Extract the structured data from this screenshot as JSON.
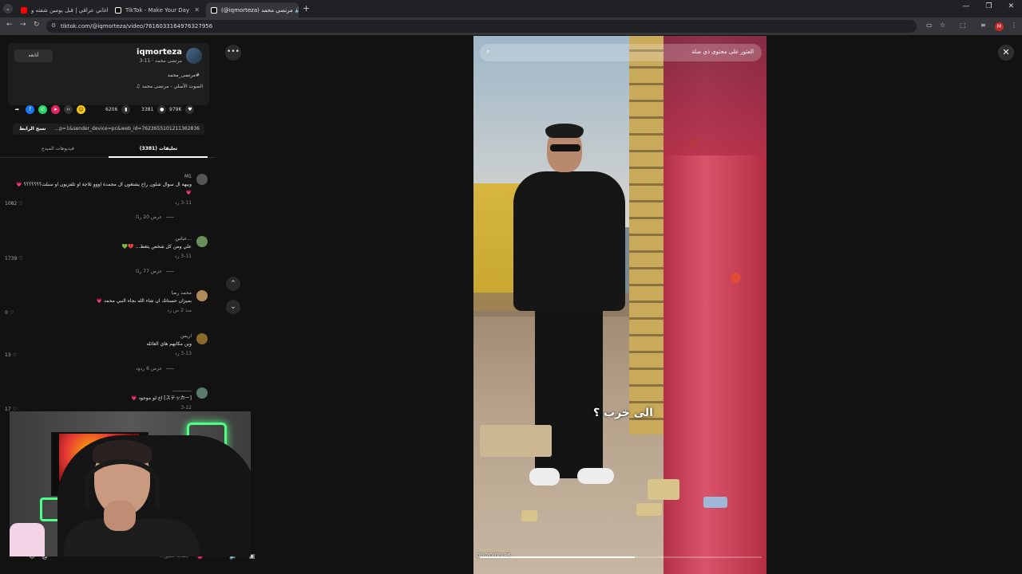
{
  "browser": {
    "tabs": [
      {
        "label": "اغاني عراقي | قبل يومين شفته و...",
        "active": false,
        "favicon_color": "#ff0000"
      },
      {
        "label": "TikTok - Make Your Day",
        "active": false,
        "favicon_color": "#ffffff"
      },
      {
        "label": "(@iqmorteza) مرتضى محمد 🔊",
        "active": true,
        "favicon_color": "#ffffff"
      }
    ],
    "url": "tiktok.com/@iqmorteza/video/7616033164976327956",
    "profile_initial": "M"
  },
  "author": {
    "username": "iqmorteza",
    "nickname_date": "مرتضى محمد · 11-3",
    "follow_label": "أتابعه",
    "description": "#مرتضى_محمد",
    "music": "الصوت الأصلي - مرتضى محمد"
  },
  "stats": {
    "likes": "979K",
    "comments": "3381",
    "saves": "6206"
  },
  "link": {
    "copy_label": "نسخ الرابط",
    "text": "...p=1&sender_device=pc&web_id=7623655101211362836"
  },
  "tabs": {
    "comments_label": "تعليقات (3381)",
    "creator_videos_label": "فيديوهات المبدع"
  },
  "comments": [
    {
      "user": "M1",
      "text": "ويبهة ال سوال شلون راح يشتغون ال مجمدة اووو ثلاجة او تلفزيون او سبلت؟؟؟؟؟؟؟ 💗💗",
      "time": "3-11 رد",
      "likes": "1082",
      "replies": "عرض 20 ردًا"
    },
    {
      "user": "...عباس",
      "text": "علي ومن كل شخص يتعظ... 💔💚",
      "time": "3-11 رد",
      "likes": "1739",
      "replies": "عرض 77 ردًا"
    },
    {
      "user": "محمد رضا",
      "text": "بميزان حسناتك ان شاء الله بجاه النبي محمد 💗",
      "time": "منذ 2 س رد",
      "likes": "0",
      "replies": ""
    },
    {
      "user": "اريس",
      "text": "وين مكانهم هاي العائله",
      "time": "3-13 رد",
      "likes": "13",
      "replies": "عرض 6 ردود"
    },
    {
      "user": "————",
      "text": "[ステッカー] اخ لو موجود 💗",
      "time": "3-12",
      "likes": "17",
      "replies": ""
    }
  ],
  "input": {
    "placeholder": "...إضافة تعليق"
  },
  "video": {
    "search_placeholder": "العثور على محتوى ذي صلة",
    "caption": "الى خرب ؟",
    "time": "00:20/00:36",
    "progress": 0.55
  }
}
